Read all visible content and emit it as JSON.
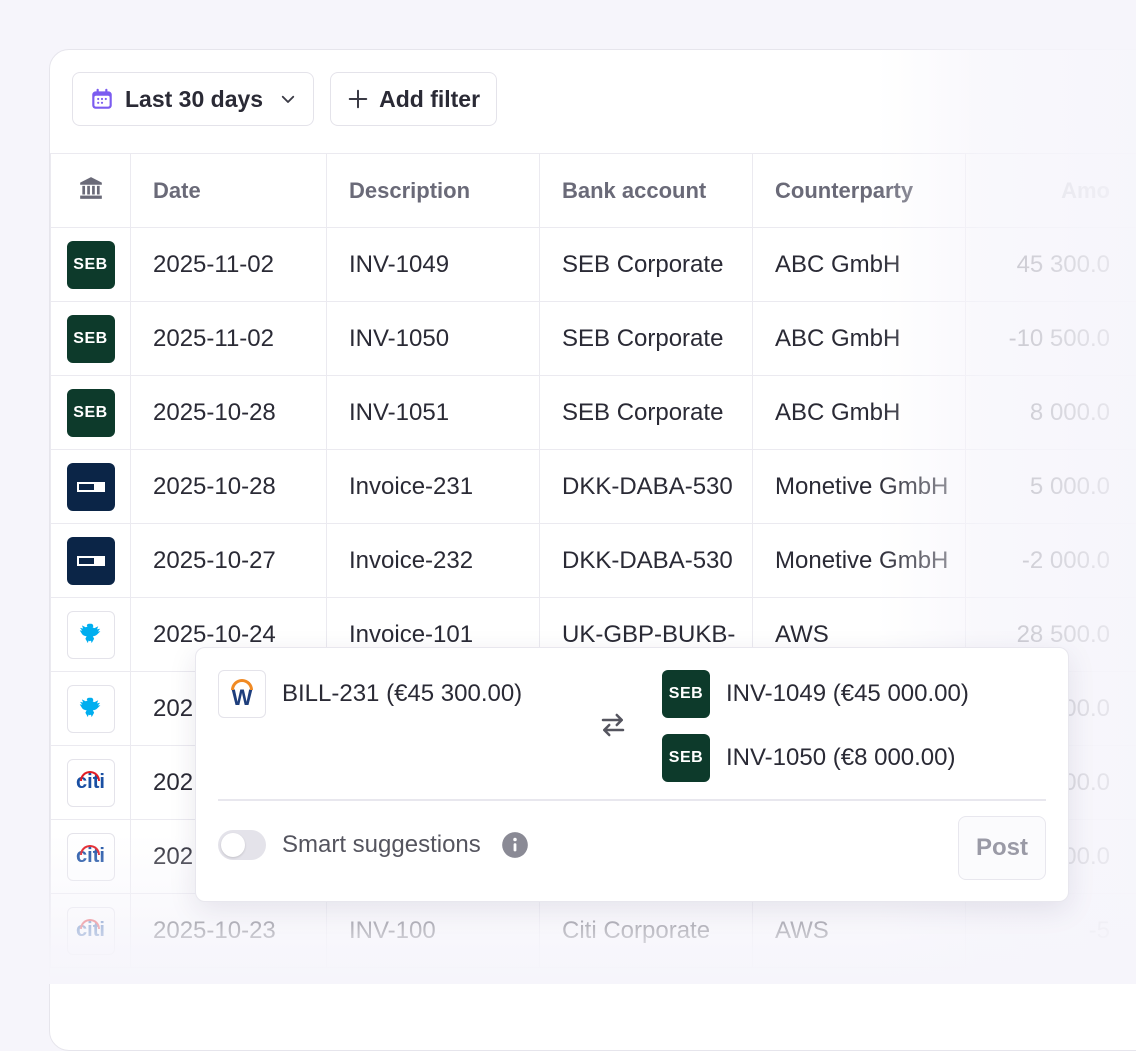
{
  "toolbar": {
    "date_range_label": "Last 30 days",
    "add_filter_label": "Add filter"
  },
  "table": {
    "columns": [
      "Date",
      "Description",
      "Bank account",
      "Counterparty",
      "Amo"
    ],
    "rows": [
      {
        "bank": "seb",
        "date": "2025-11-02",
        "description": "INV-1049",
        "account": "SEB Corporate",
        "counterparty": "ABC GmbH",
        "amount": "45 300.0"
      },
      {
        "bank": "seb",
        "date": "2025-11-02",
        "description": "INV-1050",
        "account": "SEB Corporate",
        "counterparty": "ABC GmbH",
        "amount": "-10 500.0"
      },
      {
        "bank": "seb",
        "date": "2025-10-28",
        "description": "INV-1051",
        "account": "SEB Corporate",
        "counterparty": "ABC GmbH",
        "amount": "8 000.0"
      },
      {
        "bank": "danske",
        "date": "2025-10-28",
        "description": "Invoice-231",
        "account": "DKK-DABA-530",
        "counterparty": "Monetive GmbH",
        "amount": "5 000.0"
      },
      {
        "bank": "danske",
        "date": "2025-10-27",
        "description": "Invoice-232",
        "account": "DKK-DABA-530",
        "counterparty": "Monetive GmbH",
        "amount": "-2 000.0"
      },
      {
        "bank": "barclays",
        "date": "2025-10-24",
        "description": "Invoice-101",
        "account": "UK-GBP-BUKB-",
        "counterparty": "AWS",
        "amount": "28 500.0"
      },
      {
        "bank": "barclays",
        "date": "202",
        "description": "",
        "account": "",
        "counterparty": "",
        "amount": "00.0"
      },
      {
        "bank": "citi",
        "date": "202",
        "description": "",
        "account": "",
        "counterparty": "",
        "amount": "00.0"
      },
      {
        "bank": "citi",
        "date": "202",
        "description": "",
        "account": "",
        "counterparty": "",
        "amount": "00.0"
      },
      {
        "bank": "citi",
        "date": "2025-10-23",
        "description": "INV-100",
        "account": "Citi Corporate",
        "counterparty": "AWS",
        "amount": "-5"
      }
    ]
  },
  "bank_logos": {
    "seb": "SEB",
    "citi": "citi"
  },
  "match_popup": {
    "bill_label": "BILL-231 (€45 300.00)",
    "matches": [
      {
        "label": "INV-1049 (€45 000.00)"
      },
      {
        "label": "INV-1050 (€8 000.00)"
      }
    ],
    "smart_suggestions_label": "Smart suggestions",
    "post_label": "Post"
  }
}
